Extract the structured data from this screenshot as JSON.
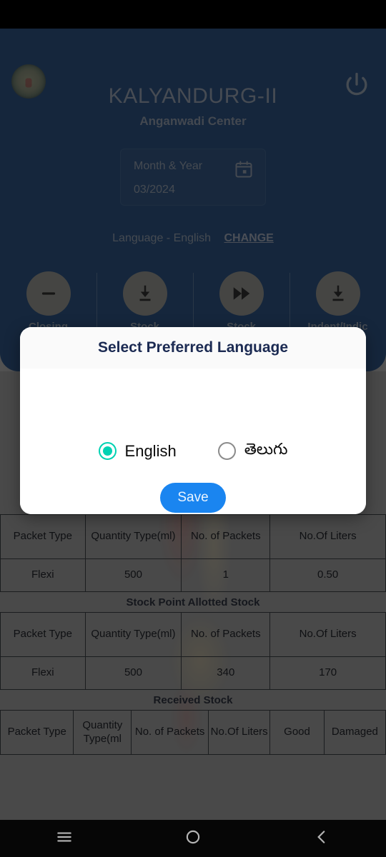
{
  "header": {
    "emblem_icon": "government-emblem-icon",
    "power_icon": "power-icon",
    "center_name": "KALYANDURG-II",
    "center_subtitle": "Anganwadi Center",
    "month_label": "Month & Year",
    "month_value": "03/2024",
    "calendar_icon": "calendar-icon",
    "language_text": "Language - English",
    "change_label": "CHANGE",
    "bg_color": "#0d3b72"
  },
  "actions": [
    {
      "icon": "minus-circle-icon",
      "label": "Closing"
    },
    {
      "icon": "download-icon",
      "label": "Stock"
    },
    {
      "icon": "forward-fast-icon",
      "label": "Stock"
    },
    {
      "icon": "download-icon",
      "label": "Indent/Indic"
    }
  ],
  "sections": [
    {
      "title": "",
      "columns": [
        "Packet Type",
        "Quantity Type(ml)",
        "No. of Packets",
        "No.Of Liters"
      ],
      "rows": [
        [
          "Flexi",
          "500",
          "1",
          "0.50"
        ]
      ]
    },
    {
      "title": "Stock Point Allotted Stock",
      "columns": [
        "Packet Type",
        "Quantity Type(ml)",
        "No. of Packets",
        "No.Of Liters"
      ],
      "rows": [
        [
          "Flexi",
          "500",
          "340",
          "170"
        ]
      ]
    },
    {
      "title": "Received Stock",
      "columns": [
        "Packet Type",
        "Quantity Type(ml",
        "No. of Packets",
        "No.Of Liters",
        "Good",
        "Damaged"
      ],
      "rows": []
    }
  ],
  "dialog": {
    "title": "Select Preferred Language",
    "options": [
      {
        "label": "English",
        "selected": true
      },
      {
        "label": "తెలుగు",
        "selected": false
      }
    ],
    "save_label": "Save",
    "accent_color": "#00d2b3",
    "save_color": "#1a85f0",
    "title_color": "#1b2a52"
  },
  "nav": {
    "menu_icon": "menu-icon",
    "home_icon": "home-circle-icon",
    "back_icon": "back-chevron-icon"
  }
}
